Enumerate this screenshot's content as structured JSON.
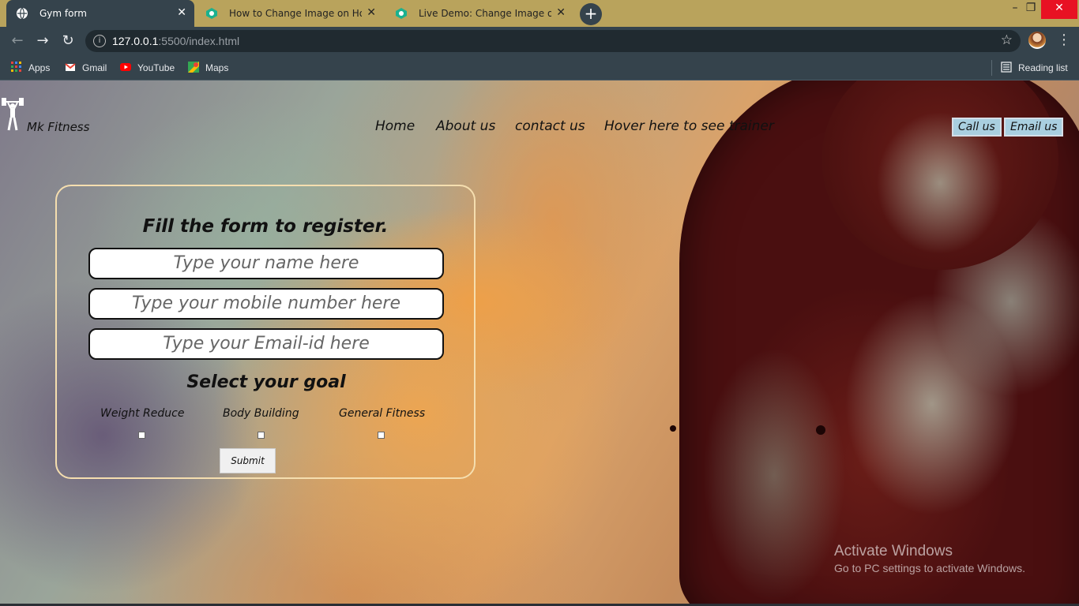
{
  "browser": {
    "tabs": [
      {
        "title": "Gym form",
        "active": true,
        "icon": "globe-icon"
      },
      {
        "title": "How to Change Image on Hover",
        "active": false,
        "icon": "geeks-icon"
      },
      {
        "title": "Live Demo: Change Image on Ho",
        "active": false,
        "icon": "geeks-icon"
      }
    ],
    "new_tab": "+",
    "window_controls": {
      "minimize": "–",
      "maximize": "❐",
      "close": "✕"
    },
    "url_host": "127.0.0.1",
    "url_path": ":5500/index.html",
    "bookmarks": [
      {
        "label": "Apps",
        "icon": "apps-grid-icon"
      },
      {
        "label": "Gmail",
        "icon": "gmail-icon"
      },
      {
        "label": "YouTube",
        "icon": "youtube-icon"
      },
      {
        "label": "Maps",
        "icon": "maps-icon"
      }
    ],
    "reading_list": "Reading list"
  },
  "page": {
    "brand": "Mk Fitness",
    "nav": [
      "Home",
      "About us",
      "contact us",
      "Hover here to see trainer"
    ],
    "call_btn": "Call us",
    "email_btn": "Email us",
    "form": {
      "title": "Fill the form to register.",
      "name_placeholder": "Type your name here",
      "mobile_placeholder": "Type your mobile number here",
      "email_placeholder": "Type your Email-id here",
      "goal_title": "Select your goal",
      "goals": [
        "Weight Reduce",
        "Body Building",
        "General Fitness"
      ],
      "submit": "Submit"
    }
  },
  "watermark": {
    "line1": "Activate Windows",
    "line2": "Go to PC settings to activate Windows."
  },
  "colors": {
    "tabbar": "#b9a35c",
    "chrome": "#35434c",
    "accent_button": "#a9cfe0",
    "form_border": "#f5deaf"
  }
}
